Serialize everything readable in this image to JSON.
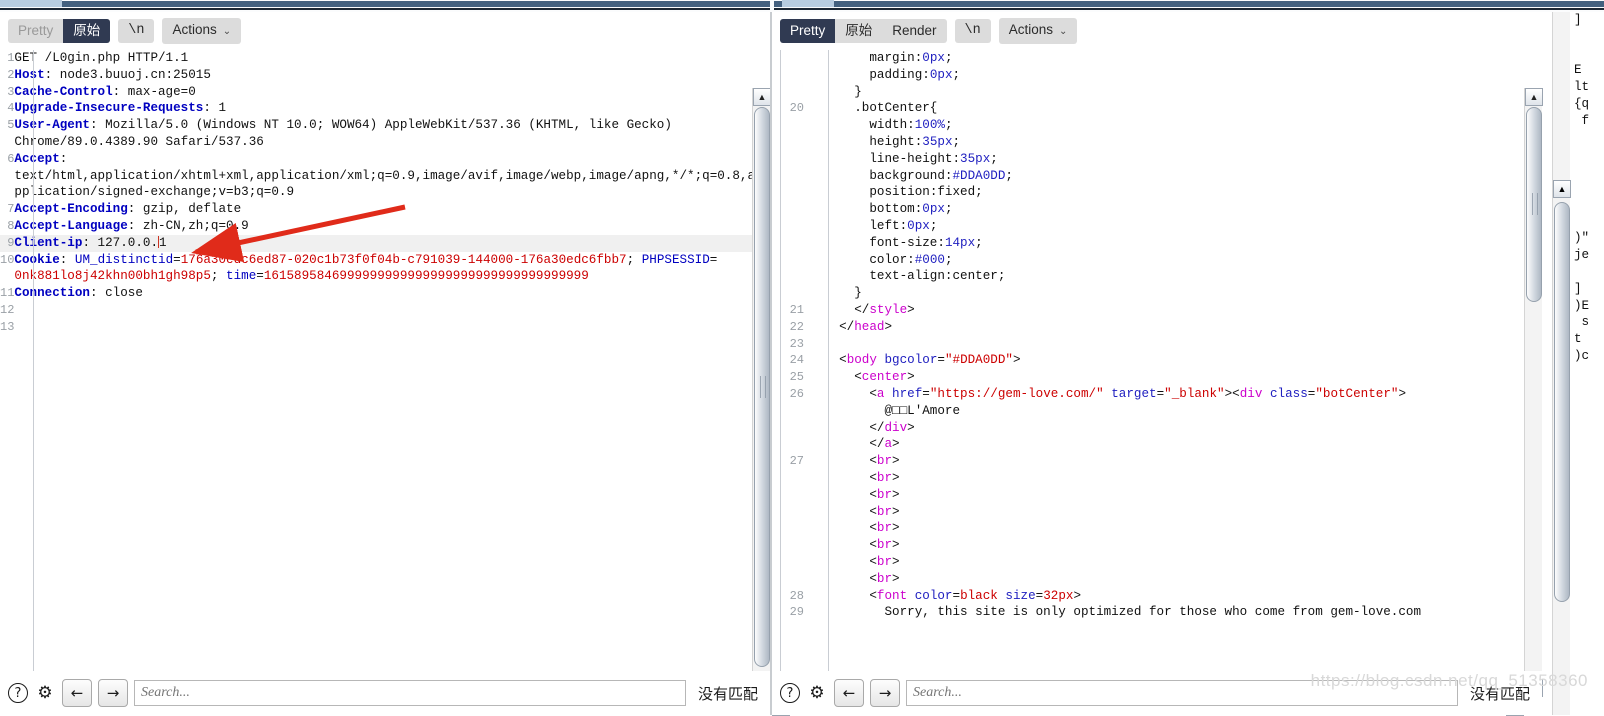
{
  "window": {
    "accent_dark": "#303a52",
    "titlebar_color": "#44617f",
    "tab_highlight": "#b8cde0"
  },
  "watermark": "https://blog.csdn.net/qq_51358360",
  "left_panel": {
    "toolbar": {
      "pretty_label": "Pretty",
      "raw_label": "原始",
      "newline_label": "\\n",
      "actions_label": "Actions",
      "caret_glyph": "⌄"
    },
    "lines": [
      {
        "n": "1",
        "segs": [
          {
            "t": "GET /L0gin.php HTTP/1.1",
            "c": "k-plain"
          }
        ]
      },
      {
        "n": "2",
        "segs": [
          {
            "t": "Host",
            "c": "k-hdr"
          },
          {
            "t": ": node3.buuoj.cn:25015",
            "c": "k-plain"
          }
        ]
      },
      {
        "n": "3",
        "segs": [
          {
            "t": "Cache-Control",
            "c": "k-hdr"
          },
          {
            "t": ": max-age=0",
            "c": "k-plain"
          }
        ]
      },
      {
        "n": "4",
        "segs": [
          {
            "t": "Upgrade-Insecure-Requests",
            "c": "k-hdr"
          },
          {
            "t": ": 1",
            "c": "k-plain"
          }
        ]
      },
      {
        "n": "5",
        "segs": [
          {
            "t": "User-Agent",
            "c": "k-hdr"
          },
          {
            "t": ": Mozilla/5.0 (Windows NT 10.0; WOW64) AppleWebKit/537.36 (KHTML, like Gecko)",
            "c": "k-plain"
          }
        ]
      },
      {
        "n": "",
        "segs": [
          {
            "t": "Chrome/89.0.4389.90 Safari/537.36",
            "c": "k-plain"
          }
        ]
      },
      {
        "n": "6",
        "segs": [
          {
            "t": "Accept",
            "c": "k-hdr"
          },
          {
            "t": ":",
            "c": "k-plain"
          }
        ]
      },
      {
        "n": "",
        "segs": [
          {
            "t": "text/html,application/xhtml+xml,application/xml;q=0.9,image/avif,image/webp,image/apng,*/*;q=0.8,a",
            "c": "k-plain"
          }
        ]
      },
      {
        "n": "",
        "segs": [
          {
            "t": "pplication/signed-exchange;v=b3;q=0.9",
            "c": "k-plain"
          }
        ]
      },
      {
        "n": "7",
        "segs": [
          {
            "t": "Accept-Encoding",
            "c": "k-hdr"
          },
          {
            "t": ": gzip, deflate",
            "c": "k-plain"
          }
        ]
      },
      {
        "n": "8",
        "segs": [
          {
            "t": "Accept-Language",
            "c": "k-hdr"
          },
          {
            "t": ": zh-CN,zh;q=0.9",
            "c": "k-plain"
          }
        ]
      },
      {
        "n": "9",
        "hl": true,
        "segs": [
          {
            "t": "Client-ip",
            "c": "k-hdr"
          },
          {
            "t": ": 127.0.0.",
            "c": "k-plain"
          },
          {
            "t": "|",
            "c": "caret"
          },
          {
            "t": "1",
            "c": "k-plain"
          }
        ]
      },
      {
        "n": "10",
        "segs": [
          {
            "t": "Cookie",
            "c": "k-hdr"
          },
          {
            "t": ": ",
            "c": "k-plain"
          },
          {
            "t": "UM_distinctid",
            "c": "k-blue"
          },
          {
            "t": "=",
            "c": "k-plain"
          },
          {
            "t": "176a30edc6ed87-020c1b73f0f04b-c791039-144000-176a30edc6fbb7",
            "c": "k-red"
          },
          {
            "t": "; ",
            "c": "k-plain"
          },
          {
            "t": "PHPSESSID",
            "c": "k-blue"
          },
          {
            "t": "=",
            "c": "k-plain"
          }
        ]
      },
      {
        "n": "",
        "segs": [
          {
            "t": "0nk881lo8j42khn00bh1gh98p5",
            "c": "k-red"
          },
          {
            "t": "; ",
            "c": "k-plain"
          },
          {
            "t": "time",
            "c": "k-blue"
          },
          {
            "t": "=",
            "c": "k-plain"
          },
          {
            "t": "1615895846999999999999999999999999999999999",
            "c": "k-red"
          }
        ]
      },
      {
        "n": "11",
        "segs": [
          {
            "t": "Connection",
            "c": "k-hdr"
          },
          {
            "t": ": close",
            "c": "k-plain"
          }
        ]
      },
      {
        "n": "12",
        "segs": [
          {
            "t": "",
            "c": "k-plain"
          }
        ]
      },
      {
        "n": "13",
        "segs": [
          {
            "t": "",
            "c": "k-plain"
          }
        ]
      }
    ],
    "bottom": {
      "help_glyph": "?",
      "gear_glyph": "⚙",
      "prev_glyph": "←",
      "next_glyph": "→",
      "search_placeholder": "Search...",
      "match_status": "没有匹配"
    }
  },
  "right_panel": {
    "toolbar": {
      "pretty_label": "Pretty",
      "raw_label": "原始",
      "render_label": "Render",
      "newline_label": "\\n",
      "actions_label": "Actions",
      "caret_glyph": "⌄"
    },
    "lines": [
      {
        "n": "",
        "segs": [
          {
            "t": "      ",
            "c": "k-plain"
          },
          {
            "t": "margin",
            "c": "k-plain"
          },
          {
            "t": ":",
            "c": "k-plain"
          },
          {
            "t": "0px",
            "c": "k-attr"
          },
          {
            "t": ";",
            "c": "k-plain"
          }
        ]
      },
      {
        "n": "",
        "segs": [
          {
            "t": "      ",
            "c": "k-plain"
          },
          {
            "t": "padding",
            "c": "k-plain"
          },
          {
            "t": ":",
            "c": "k-plain"
          },
          {
            "t": "0px",
            "c": "k-attr"
          },
          {
            "t": ";",
            "c": "k-plain"
          }
        ]
      },
      {
        "n": "",
        "segs": [
          {
            "t": "    }",
            "c": "k-plain"
          }
        ]
      },
      {
        "n": "20",
        "segs": [
          {
            "t": "    .botCenter{",
            "c": "k-plain"
          }
        ]
      },
      {
        "n": "",
        "segs": [
          {
            "t": "      width",
            "c": "k-plain"
          },
          {
            "t": ":",
            "c": "k-plain"
          },
          {
            "t": "100%",
            "c": "k-attr"
          },
          {
            "t": ";",
            "c": "k-plain"
          }
        ]
      },
      {
        "n": "",
        "segs": [
          {
            "t": "      height",
            "c": "k-plain"
          },
          {
            "t": ":",
            "c": "k-plain"
          },
          {
            "t": "35px",
            "c": "k-attr"
          },
          {
            "t": ";",
            "c": "k-plain"
          }
        ]
      },
      {
        "n": "",
        "segs": [
          {
            "t": "      line-height",
            "c": "k-plain"
          },
          {
            "t": ":",
            "c": "k-plain"
          },
          {
            "t": "35px",
            "c": "k-attr"
          },
          {
            "t": ";",
            "c": "k-plain"
          }
        ]
      },
      {
        "n": "",
        "segs": [
          {
            "t": "      background",
            "c": "k-plain"
          },
          {
            "t": ":",
            "c": "k-plain"
          },
          {
            "t": "#DDA0DD",
            "c": "k-attr"
          },
          {
            "t": ";",
            "c": "k-plain"
          }
        ]
      },
      {
        "n": "",
        "segs": [
          {
            "t": "      position",
            "c": "k-plain"
          },
          {
            "t": ":",
            "c": "k-plain"
          },
          {
            "t": "fixed;",
            "c": "k-plain"
          }
        ]
      },
      {
        "n": "",
        "segs": [
          {
            "t": "      bottom",
            "c": "k-plain"
          },
          {
            "t": ":",
            "c": "k-plain"
          },
          {
            "t": "0px",
            "c": "k-attr"
          },
          {
            "t": ";",
            "c": "k-plain"
          }
        ]
      },
      {
        "n": "",
        "segs": [
          {
            "t": "      left",
            "c": "k-plain"
          },
          {
            "t": ":",
            "c": "k-plain"
          },
          {
            "t": "0px",
            "c": "k-attr"
          },
          {
            "t": ";",
            "c": "k-plain"
          }
        ]
      },
      {
        "n": "",
        "segs": [
          {
            "t": "      font-size",
            "c": "k-plain"
          },
          {
            "t": ":",
            "c": "k-plain"
          },
          {
            "t": "14px",
            "c": "k-attr"
          },
          {
            "t": ";",
            "c": "k-plain"
          }
        ]
      },
      {
        "n": "",
        "segs": [
          {
            "t": "      color",
            "c": "k-plain"
          },
          {
            "t": ":",
            "c": "k-plain"
          },
          {
            "t": "#000",
            "c": "k-attr"
          },
          {
            "t": ";",
            "c": "k-plain"
          }
        ]
      },
      {
        "n": "",
        "segs": [
          {
            "t": "      text-align",
            "c": "k-plain"
          },
          {
            "t": ":",
            "c": "k-plain"
          },
          {
            "t": "center;",
            "c": "k-plain"
          }
        ]
      },
      {
        "n": "",
        "segs": [
          {
            "t": "    }",
            "c": "k-plain"
          }
        ]
      },
      {
        "n": "21",
        "segs": [
          {
            "t": "    </",
            "c": "k-plain"
          },
          {
            "t": "style",
            "c": "k-tag"
          },
          {
            "t": ">",
            "c": "k-plain"
          }
        ]
      },
      {
        "n": "22",
        "segs": [
          {
            "t": "  </",
            "c": "k-plain"
          },
          {
            "t": "head",
            "c": "k-tag"
          },
          {
            "t": ">",
            "c": "k-plain"
          }
        ]
      },
      {
        "n": "23",
        "segs": [
          {
            "t": "",
            "c": "k-plain"
          }
        ]
      },
      {
        "n": "24",
        "segs": [
          {
            "t": "  <",
            "c": "k-plain"
          },
          {
            "t": "body ",
            "c": "k-tag"
          },
          {
            "t": "bgcolor",
            "c": "k-attr"
          },
          {
            "t": "=",
            "c": "k-plain"
          },
          {
            "t": "\"#DDA0DD\"",
            "c": "k-val"
          },
          {
            "t": ">",
            "c": "k-plain"
          }
        ]
      },
      {
        "n": "25",
        "segs": [
          {
            "t": "    <",
            "c": "k-plain"
          },
          {
            "t": "center",
            "c": "k-tag"
          },
          {
            "t": ">",
            "c": "k-plain"
          }
        ]
      },
      {
        "n": "26",
        "segs": [
          {
            "t": "      <",
            "c": "k-plain"
          },
          {
            "t": "a ",
            "c": "k-tag"
          },
          {
            "t": "href",
            "c": "k-attr"
          },
          {
            "t": "=",
            "c": "k-plain"
          },
          {
            "t": "\"https://gem-love.com/\"",
            "c": "k-val"
          },
          {
            "t": " ",
            "c": "k-plain"
          },
          {
            "t": "target",
            "c": "k-attr"
          },
          {
            "t": "=",
            "c": "k-plain"
          },
          {
            "t": "\"_blank\"",
            "c": "k-val"
          },
          {
            "t": "><",
            "c": "k-plain"
          },
          {
            "t": "div ",
            "c": "k-tag"
          },
          {
            "t": "class",
            "c": "k-attr"
          },
          {
            "t": "=",
            "c": "k-plain"
          },
          {
            "t": "\"botCenter\"",
            "c": "k-val"
          },
          {
            "t": ">",
            "c": "k-plain"
          }
        ]
      },
      {
        "n": "",
        "segs": [
          {
            "t": "        @□□L'Amore",
            "c": "k-plain"
          }
        ]
      },
      {
        "n": "",
        "segs": [
          {
            "t": "      </",
            "c": "k-plain"
          },
          {
            "t": "div",
            "c": "k-tag"
          },
          {
            "t": ">",
            "c": "k-plain"
          }
        ]
      },
      {
        "n": "",
        "segs": [
          {
            "t": "      </",
            "c": "k-plain"
          },
          {
            "t": "a",
            "c": "k-tag"
          },
          {
            "t": ">",
            "c": "k-plain"
          }
        ]
      },
      {
        "n": "27",
        "segs": [
          {
            "t": "      <",
            "c": "k-plain"
          },
          {
            "t": "br",
            "c": "k-tag"
          },
          {
            "t": ">",
            "c": "k-plain"
          }
        ]
      },
      {
        "n": "",
        "segs": [
          {
            "t": "      <",
            "c": "k-plain"
          },
          {
            "t": "br",
            "c": "k-tag"
          },
          {
            "t": ">",
            "c": "k-plain"
          }
        ]
      },
      {
        "n": "",
        "segs": [
          {
            "t": "      <",
            "c": "k-plain"
          },
          {
            "t": "br",
            "c": "k-tag"
          },
          {
            "t": ">",
            "c": "k-plain"
          }
        ]
      },
      {
        "n": "",
        "segs": [
          {
            "t": "      <",
            "c": "k-plain"
          },
          {
            "t": "br",
            "c": "k-tag"
          },
          {
            "t": ">",
            "c": "k-plain"
          }
        ]
      },
      {
        "n": "",
        "segs": [
          {
            "t": "      <",
            "c": "k-plain"
          },
          {
            "t": "br",
            "c": "k-tag"
          },
          {
            "t": ">",
            "c": "k-plain"
          }
        ]
      },
      {
        "n": "",
        "segs": [
          {
            "t": "      <",
            "c": "k-plain"
          },
          {
            "t": "br",
            "c": "k-tag"
          },
          {
            "t": ">",
            "c": "k-plain"
          }
        ]
      },
      {
        "n": "",
        "segs": [
          {
            "t": "      <",
            "c": "k-plain"
          },
          {
            "t": "br",
            "c": "k-tag"
          },
          {
            "t": ">",
            "c": "k-plain"
          }
        ]
      },
      {
        "n": "",
        "segs": [
          {
            "t": "      <",
            "c": "k-plain"
          },
          {
            "t": "br",
            "c": "k-tag"
          },
          {
            "t": ">",
            "c": "k-plain"
          }
        ]
      },
      {
        "n": "28",
        "segs": [
          {
            "t": "      <",
            "c": "k-plain"
          },
          {
            "t": "font ",
            "c": "k-tag"
          },
          {
            "t": "color",
            "c": "k-attr"
          },
          {
            "t": "=",
            "c": "k-plain"
          },
          {
            "t": "black",
            "c": "k-val"
          },
          {
            "t": " ",
            "c": "k-plain"
          },
          {
            "t": "size",
            "c": "k-attr"
          },
          {
            "t": "=",
            "c": "k-plain"
          },
          {
            "t": "32px",
            "c": "k-val"
          },
          {
            "t": ">",
            "c": "k-plain"
          }
        ]
      },
      {
        "n": "29",
        "segs": [
          {
            "t": "        Sorry, this site is only optimized for those who come from gem-love.com",
            "c": "k-plain"
          }
        ]
      }
    ],
    "bottom": {
      "help_glyph": "?",
      "gear_glyph": "⚙",
      "prev_glyph": "←",
      "next_glyph": "→",
      "search_placeholder": "Search...",
      "match_status": "没有匹配"
    }
  },
  "far_panel": {
    "fragments": "]\n\n\nE\nlt\n{q\n f\n\n\n\n\n\n\n)\"\nje\n\n]\n)E\n s\nt\n)c"
  }
}
